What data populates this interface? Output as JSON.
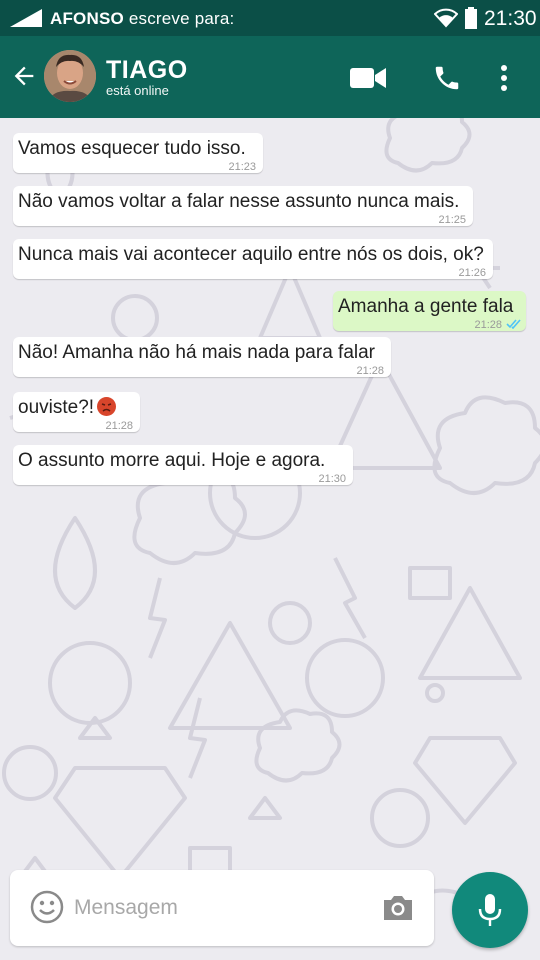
{
  "status_bar": {
    "sender": "AFONSO",
    "activity": " escreve para:",
    "time": "21:30"
  },
  "header": {
    "contact_name": "TIAGO",
    "contact_status": "está online",
    "icons": [
      "back-arrow-icon",
      "video-call-icon",
      "phone-icon",
      "more-vert-icon"
    ]
  },
  "messages": [
    {
      "text": "Vamos esquecer tudo isso.",
      "time": "21:23",
      "direction": "in"
    },
    {
      "text": "Não vamos voltar a falar nesse assunto nunca mais.",
      "time": "21:25",
      "direction": "in"
    },
    {
      "text": "Nunca mais vai acontecer aquilo entre nós os dois, ok?",
      "time": "21:26",
      "direction": "in"
    },
    {
      "text": "Amanha a gente fala",
      "time": "21:28",
      "direction": "out",
      "status": "read"
    },
    {
      "text": "Não! Amanha não há mais nada para falar",
      "time": "21:28",
      "direction": "in"
    },
    {
      "text": "ouviste?!",
      "time": "21:28",
      "direction": "in",
      "emoji": "angry-face"
    },
    {
      "text": "O assunto morre aqui. Hoje e agora.",
      "time": "21:30",
      "direction": "in"
    }
  ],
  "composer": {
    "placeholder": "Mensagem"
  },
  "colors": {
    "status_bar": "#0b4f47",
    "header": "#0e6559",
    "outgoing_bubble": "#dcf8c6",
    "incoming_bubble": "#ffffff",
    "mic_button": "#11897b",
    "read_ticks": "#4fc3f7"
  }
}
